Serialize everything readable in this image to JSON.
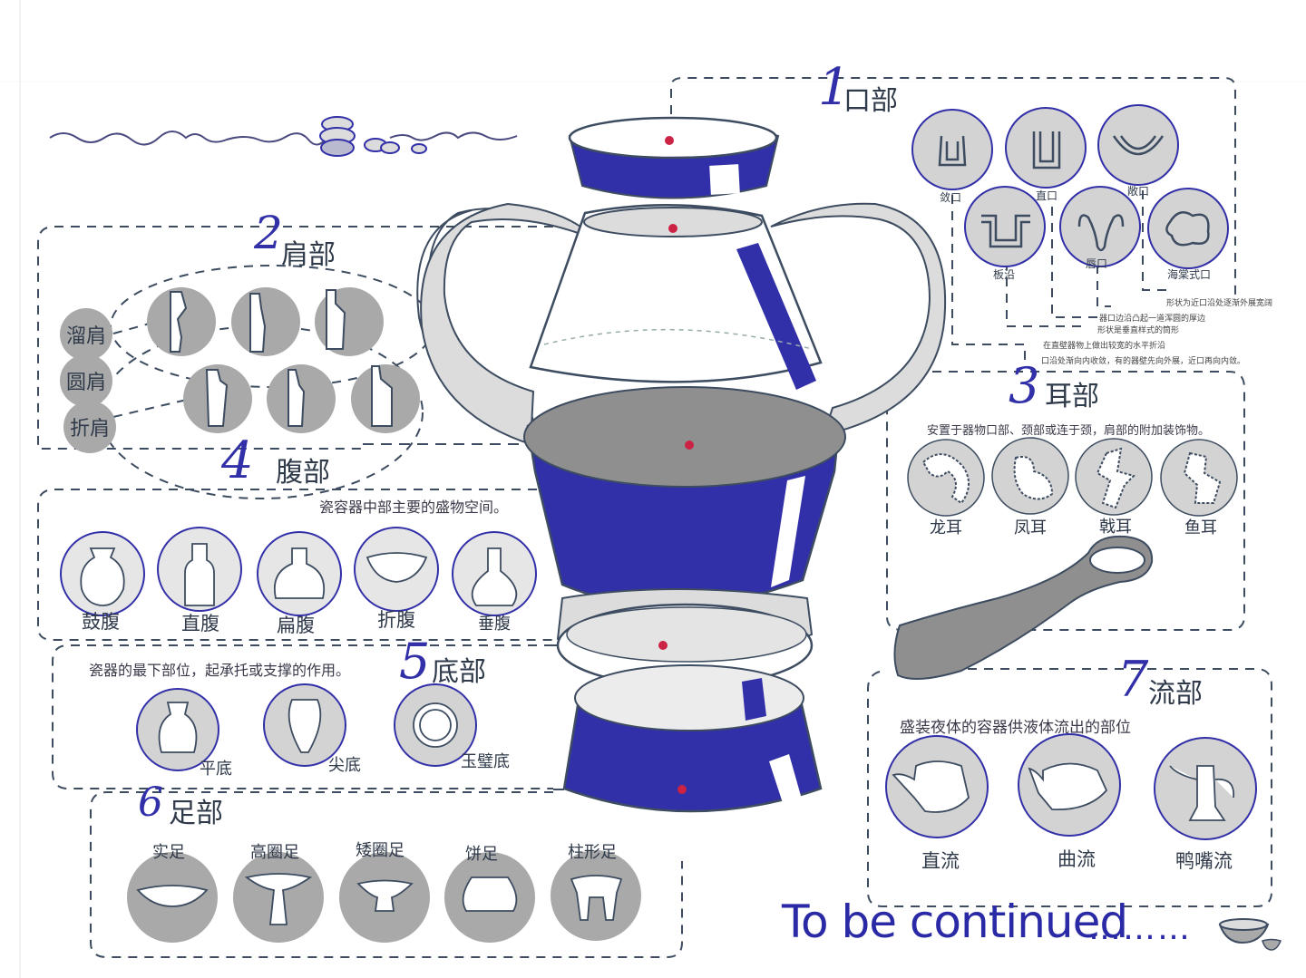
{
  "colors": {
    "blue": "#3230a8",
    "gray": "#a9a9a9",
    "light_gray": "#dcdcdc",
    "line": "#3d4c60",
    "red_dot": "#cc2244"
  },
  "sections": {
    "mouth": {
      "number": "1",
      "title": "口部",
      "types": [
        "敛口",
        "直口",
        "敞口",
        "板沿",
        "唇口",
        "海棠式口"
      ],
      "notes": [
        "形状为近口沿处逐渐外展宽阔",
        "器口边沿凸起一道浑圆的厚边",
        "形状是垂直样式的筒形",
        "在直壁器物上做出较宽的水平折沿",
        "口沿处渐向内收敛，有的器壁先向外展，近口再向内敛。"
      ]
    },
    "shoulder": {
      "number": "2",
      "title": "肩部",
      "types": [
        "溜肩",
        "圆肩",
        "折肩"
      ]
    },
    "ear": {
      "number": "3",
      "title": "耳部",
      "description": "安置于器物口部、颈部或连于颈，肩部的附加装饰物。",
      "types": [
        "龙耳",
        "凤耳",
        "戟耳",
        "鱼耳"
      ]
    },
    "belly": {
      "number": "4",
      "title": "腹部",
      "description": "瓷容器中部主要的盛物空间。",
      "types": [
        "鼓腹",
        "直腹",
        "扁腹",
        "折腹",
        "垂腹"
      ]
    },
    "base": {
      "number": "5",
      "title": "底部",
      "description": "瓷器的最下部位，起承托或支撑的作用。",
      "types": [
        "平底",
        "尖底",
        "玉璧底"
      ]
    },
    "foot": {
      "number": "6",
      "title": "足部",
      "types": [
        "实足",
        "高圈足",
        "矮圈足",
        "饼足",
        "柱形足"
      ]
    },
    "spout": {
      "number": "7",
      "title": "流部",
      "description": "盛装夜体的容器供液体流出的部位",
      "types": [
        "直流",
        "曲流",
        "鸭嘴流"
      ]
    }
  },
  "footer": {
    "text": "To be continued",
    "dots": "………"
  },
  "icons": {
    "decor_bowls": "bowls-doodle-icon",
    "footer_bowl": "bowl-icon"
  }
}
